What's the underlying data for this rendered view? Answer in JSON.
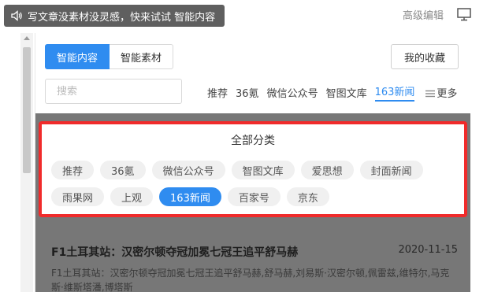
{
  "top": {
    "tip_text": "写文章没素材没灵感，快来试试 智能内容",
    "advanced_edit": "高级编辑",
    "monitor_icon": "monitor-icon",
    "speaker_icon": "speaker-icon"
  },
  "tabs": [
    {
      "label": "智能内容",
      "active": true
    },
    {
      "label": "智能素材",
      "active": false
    }
  ],
  "favorites_label": "我的收藏",
  "search": {
    "placeholder": "搜索",
    "value": ""
  },
  "quick_nav": [
    "推荐",
    "36氪",
    "微信公众号",
    "智图文库",
    "163新闻"
  ],
  "quick_nav_active": "163新闻",
  "more_label": "更多",
  "popup": {
    "title": "全部分类",
    "categories": [
      "推荐",
      "36氪",
      "微信公众号",
      "智图文库",
      "爱思想",
      "封面新闻",
      "雨果网",
      "上观",
      "163新闻",
      "百家号",
      "京东"
    ],
    "active": "163新闻"
  },
  "article": {
    "title": "F1土耳其站：汉密尔顿夺冠加冕七冠王追平舒马赫",
    "date": "2020-11-15",
    "summary": "F1土耳其站：汉密尔顿夺冠加冕七冠王追平舒马赫,舒马赫,刘易斯·汉密尔顿,佩雷兹,维特尔,马克斯·维斯塔潘,博塔斯"
  },
  "colors": {
    "accent": "#2f8cf0",
    "highlight_border": "#f02b2b",
    "overlay": "#777777"
  }
}
